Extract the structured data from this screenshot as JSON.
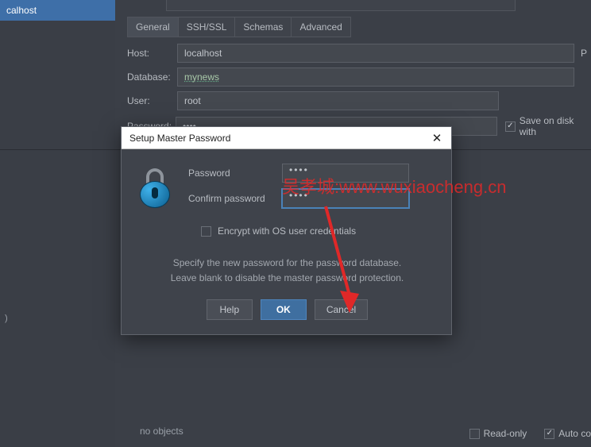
{
  "sidebar": {
    "item": "calhost",
    "marker": ")"
  },
  "tabs": [
    "General",
    "SSH/SSL",
    "Schemas",
    "Advanced"
  ],
  "activeTab": 0,
  "form": {
    "hostLabel": "Host:",
    "hostValue": "localhost",
    "hostSide": "P",
    "dbLabel": "Database:",
    "dbValue": "mynews",
    "userLabel": "User:",
    "userValue": "root",
    "pwLabel": "Password:",
    "pwValue": "••••",
    "saveDisk": "Save on disk with"
  },
  "dialog": {
    "title": "Setup Master Password",
    "pwLabel": "Password",
    "pwValue": "••••",
    "confirmLabel": "Confirm password",
    "confirmValue": "••••",
    "encrypt": "Encrypt with OS user credentials",
    "help1": "Specify the new password for the password database.",
    "help2": "Leave blank to disable the master password protection.",
    "helpBtn": "Help",
    "okBtn": "OK",
    "cancelBtn": "Cancel",
    "close": "✕"
  },
  "footer": {
    "status": "no objects",
    "readonly": "Read-only",
    "autoCommit": "Auto co"
  },
  "watermark": "吴孝城:www.wuxiaocheng.cn"
}
